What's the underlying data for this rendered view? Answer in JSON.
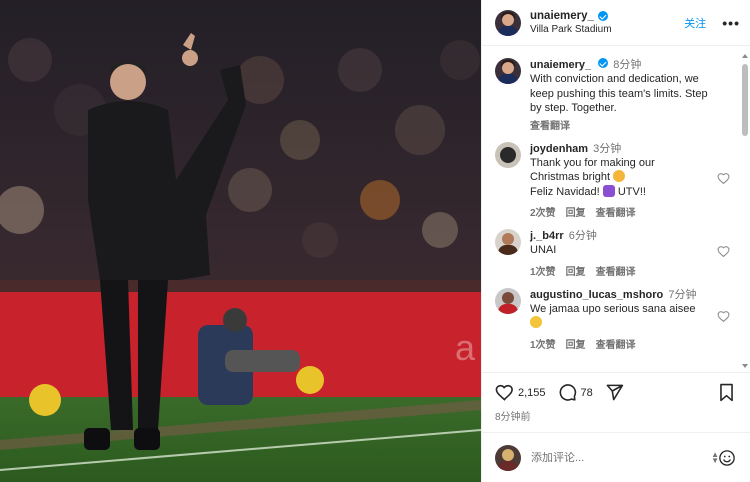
{
  "post": {
    "username": "unaiemery_",
    "location": "Villa Park Stadium",
    "follow_label": "关注",
    "more_label": "•••"
  },
  "comments": [
    {
      "username": "unaiemery_",
      "verified": true,
      "time": "8分钟",
      "text": "With conviction and dedication, we keep pushing this team's limits. Step by step. Together.",
      "translate": "查看翻译"
    },
    {
      "username": "joydenham",
      "time": "3分钟",
      "text_line1": "Thank you for making our",
      "text_line2": "Christmas bright",
      "text_line3": "Feliz Navidad!",
      "text_line3_suffix": "UTV!!",
      "likes": "2次赞",
      "reply": "回复",
      "translate": "查看翻译"
    },
    {
      "username": "j._b4rr",
      "time": "6分钟",
      "text": "UNAI",
      "likes": "1次赞",
      "reply": "回复",
      "translate": "查看翻译"
    },
    {
      "username": "augustino_lucas_mshoro",
      "time": "7分钟",
      "text": "We jamaa upo serious sana aisee",
      "likes": "1次赞",
      "reply": "回复",
      "translate": "查看翻译"
    }
  ],
  "actions": {
    "likes": "2,155",
    "comments": "78",
    "posted": "8分钟前"
  },
  "composer": {
    "placeholder": "添加评论..."
  },
  "icons": {
    "like": "heart-icon",
    "comment": "comment-icon",
    "share": "send-icon",
    "save": "bookmark-icon",
    "emoji": "emoji-icon"
  },
  "colors": {
    "accent": "#0095f6",
    "muted": "#737373",
    "divider": "#efefef"
  }
}
